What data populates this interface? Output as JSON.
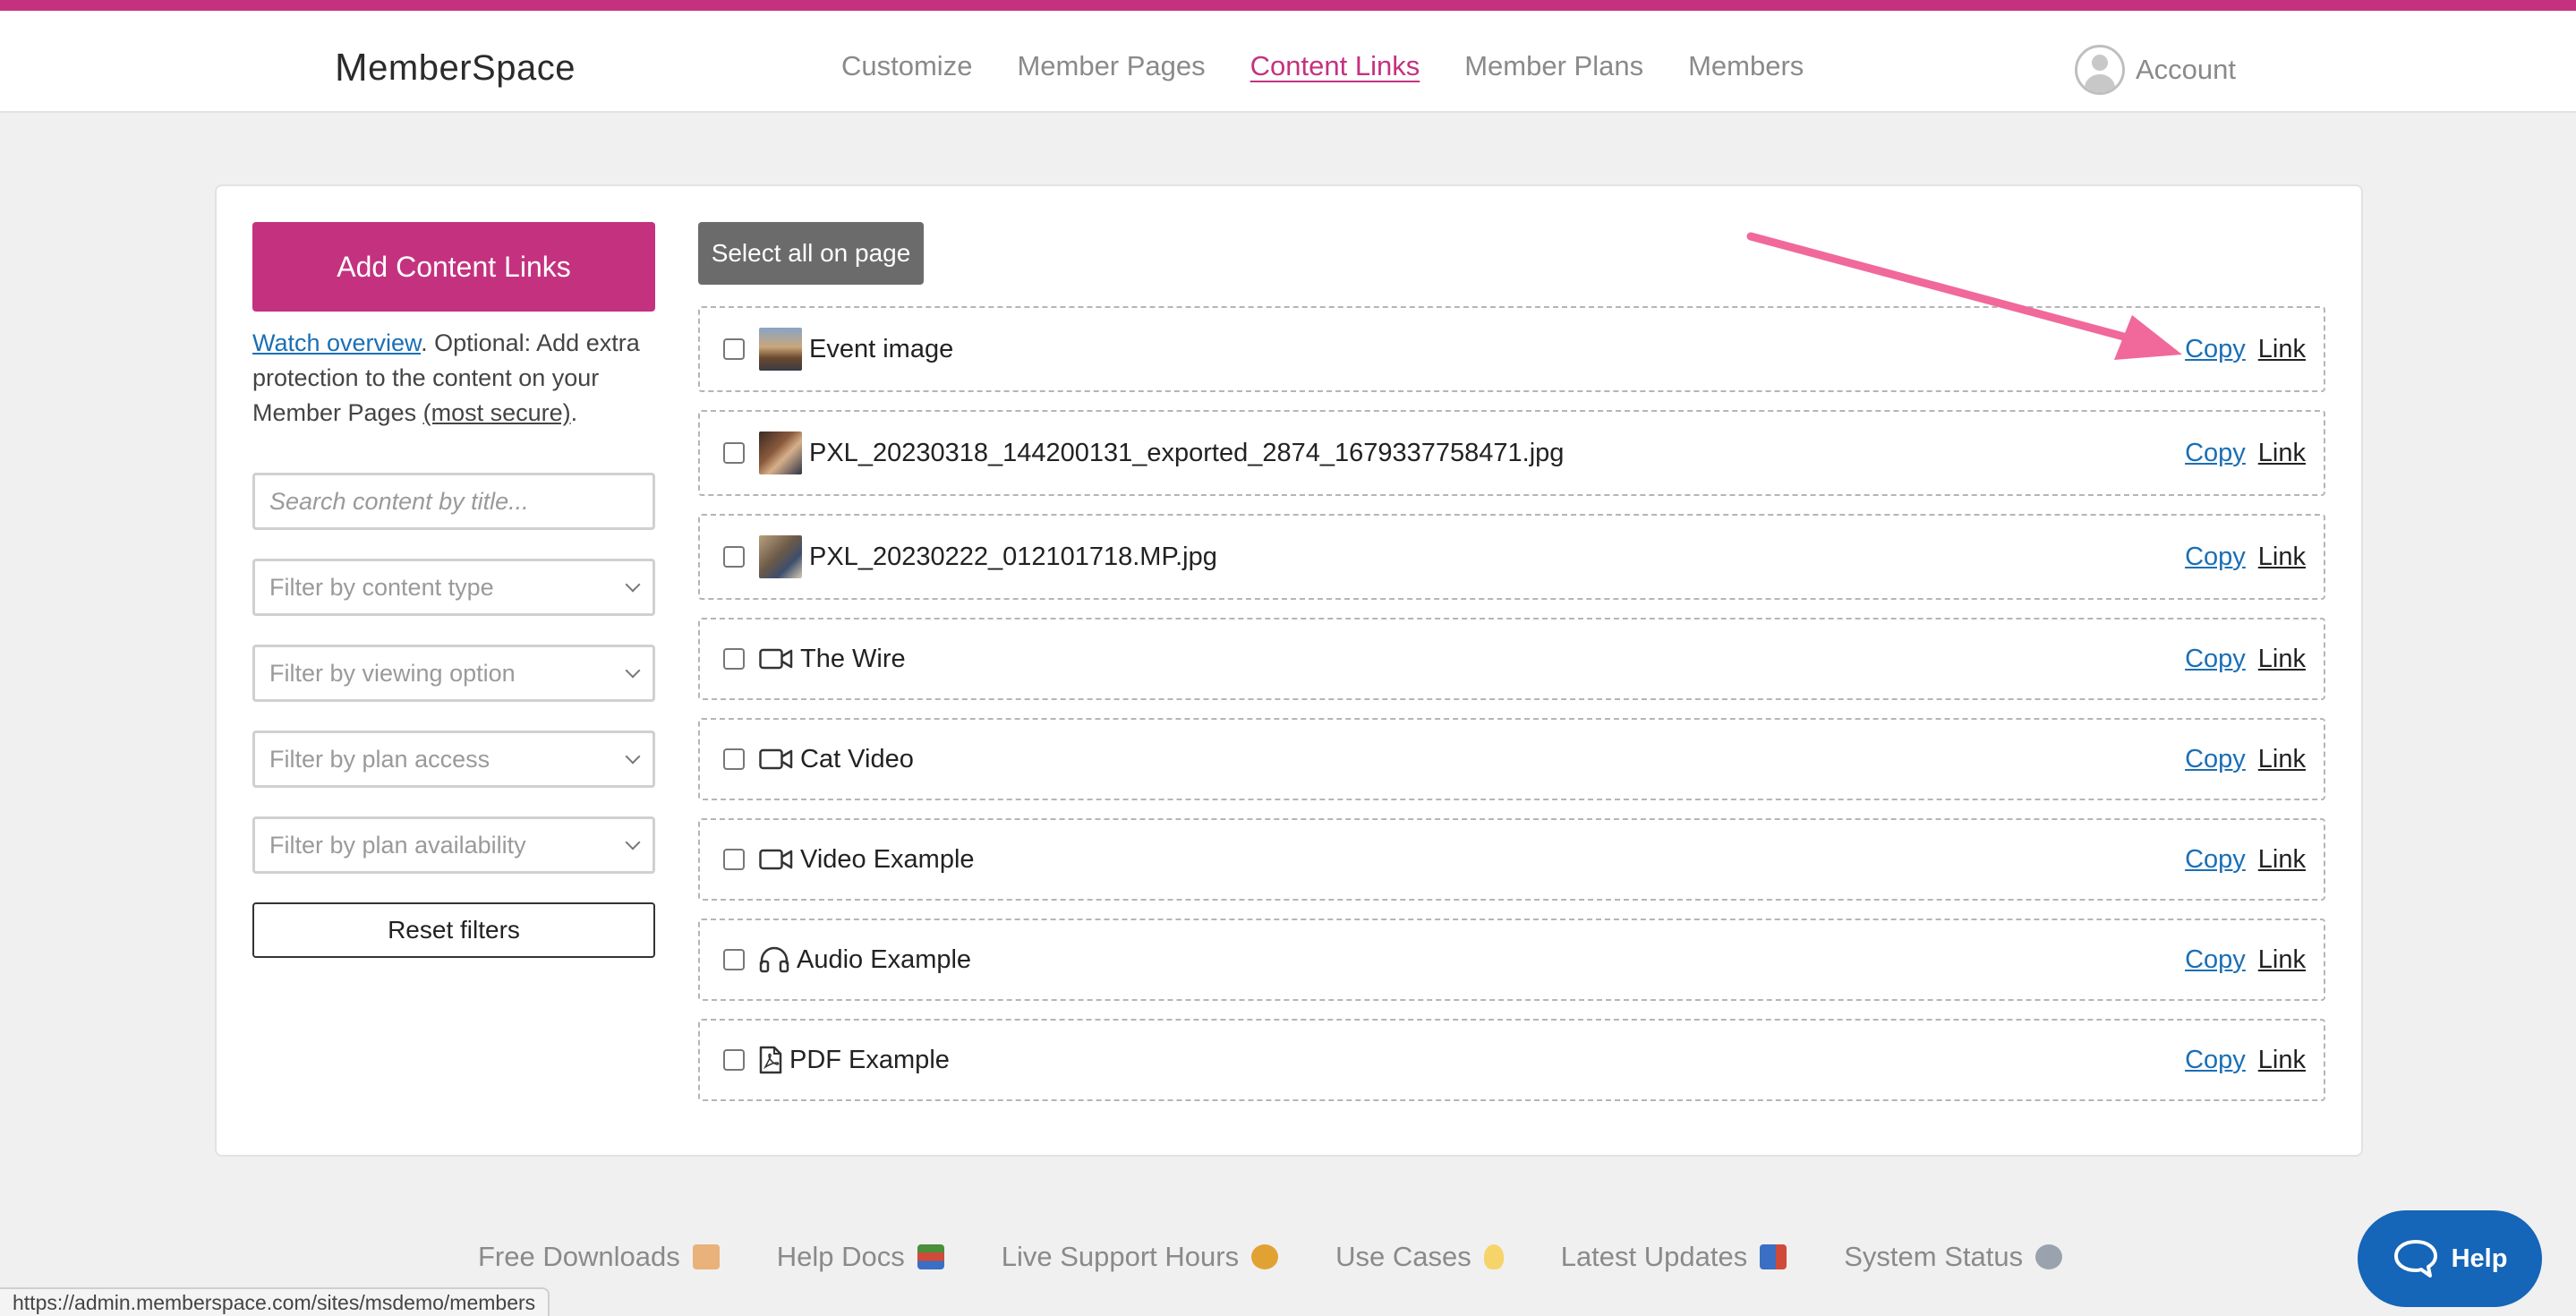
{
  "header": {
    "logo_text": "emberSpace",
    "logo_initial": "M",
    "nav": [
      "Customize",
      "Member Pages",
      "Content Links",
      "Member Plans",
      "Members"
    ],
    "active_nav": "Content Links",
    "account_label": "Account"
  },
  "sidebar": {
    "add_button": "Add Content Links",
    "watch_link": "Watch overview",
    "help_text": ". Optional: Add extra protection to the content on your Member Pages ",
    "secure_link": "(most secure)",
    "help_end": ".",
    "search_placeholder": "Search content by title...",
    "filters": [
      "Filter by content type",
      "Filter by viewing option",
      "Filter by plan access",
      "Filter by plan availability"
    ],
    "reset_button": "Reset filters"
  },
  "main": {
    "select_all": "Select all on page",
    "copy_label": "Copy",
    "link_label": "Link",
    "items": [
      {
        "title": "Event image",
        "type": "image"
      },
      {
        "title": "PXL_20230318_144200131_exported_2874_1679337758471.jpg",
        "type": "image"
      },
      {
        "title": "PXL_20230222_012101718.MP.jpg",
        "type": "image"
      },
      {
        "title": "The Wire",
        "type": "video"
      },
      {
        "title": "Cat Video",
        "type": "video"
      },
      {
        "title": "Video Example",
        "type": "video"
      },
      {
        "title": "Audio Example",
        "type": "audio"
      },
      {
        "title": "PDF Example",
        "type": "pdf"
      }
    ]
  },
  "footer": {
    "links": [
      "Free Downloads",
      "Help Docs",
      "Live Support Hours",
      "Use Cases",
      "Latest Updates",
      "System Status"
    ],
    "icons": [
      "gift-box-icon",
      "books-icon",
      "support-person-icon",
      "lightbulb-icon",
      "mailbox-icon",
      "satellite-icon"
    ]
  },
  "status_url": "https://admin.memberspace.com/sites/msdemo/members",
  "help_button": "Help",
  "colors": {
    "accent": "#c4327f",
    "link": "#1a6fb5",
    "arrow": "#f0699a",
    "help": "#1565b8"
  }
}
